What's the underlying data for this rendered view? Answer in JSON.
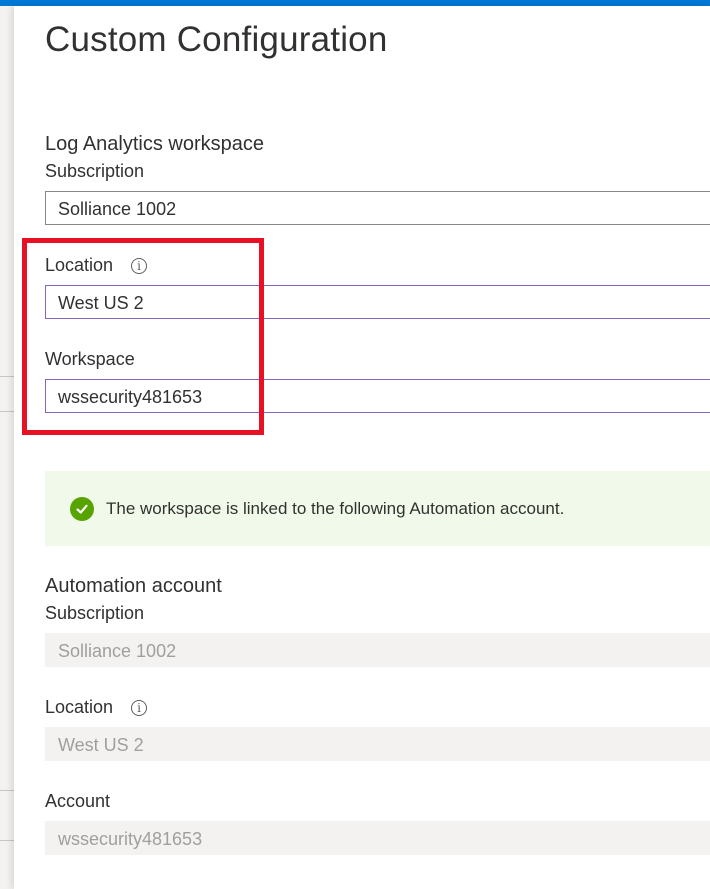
{
  "title": "Custom Configuration",
  "log_analytics": {
    "section_label": "Log Analytics workspace",
    "subscription_label": "Subscription",
    "subscription_value": "Solliance 1002",
    "location_label": "Location",
    "location_value": "West US 2",
    "workspace_label": "Workspace",
    "workspace_value": "wssecurity481653"
  },
  "message": {
    "icon": "checkmark-circle-icon",
    "text": "The workspace is linked to the following Automation account."
  },
  "automation": {
    "section_label": "Automation account",
    "subscription_label": "Subscription",
    "subscription_value": "Solliance 1002",
    "location_label": "Location",
    "location_value": "West US 2",
    "account_label": "Account",
    "account_value": "wssecurity481653"
  },
  "info_glyph": "i",
  "colors": {
    "accent": "#0078d4",
    "highlight": "#e81123",
    "success": "#57a300",
    "success_bg": "#f1faea",
    "focus_border": "#8764b8"
  }
}
